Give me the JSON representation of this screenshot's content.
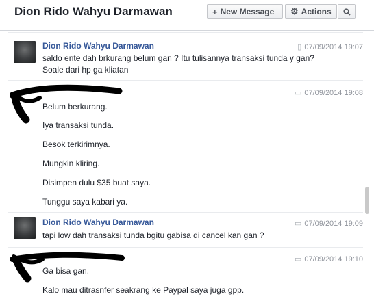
{
  "header": {
    "title": "Dion Rido Wahyu Darmawan",
    "new_message_label": "New Message",
    "actions_label": "Actions",
    "icons": {
      "new_message": "plus-icon",
      "actions": "gear-icon",
      "search": "search-icon"
    }
  },
  "thread": {
    "blocks": [
      {
        "sender": "Dion Rido Wahyu Darmawan",
        "timestamp": "07/09/2014 19:07",
        "source_icon": "mobile-icon",
        "messages": [
          "saldo ente dah brkurang belum gan ? Itu tulisannya transaksi tunda y gan? Soale dari hp ga kliatan"
        ]
      },
      {
        "sender": "",
        "timestamp": "07/09/2014 19:08",
        "source_icon": "chat-icon",
        "messages": [
          "Belum berkurang.",
          "Iya transaksi tunda.",
          "Besok terkirimnya.",
          "Mungkin kliring.",
          "Disimpen dulu $35 buat saya.",
          "Tunggu saya kabari ya."
        ]
      },
      {
        "sender": "Dion Rido Wahyu Darmawan",
        "timestamp": "07/09/2014 19:09",
        "source_icon": "chat-icon",
        "messages": [
          "tapi low dah transaksi tunda bgitu gabisa di cancel kan gan ?"
        ]
      },
      {
        "sender": "",
        "timestamp": "07/09/2014 19:10",
        "source_icon": "chat-icon",
        "messages": [
          "Ga bisa gan.",
          "Kalo mau ditrasnfer seakrang ke Paypal saya juga gpp."
        ]
      }
    ]
  }
}
